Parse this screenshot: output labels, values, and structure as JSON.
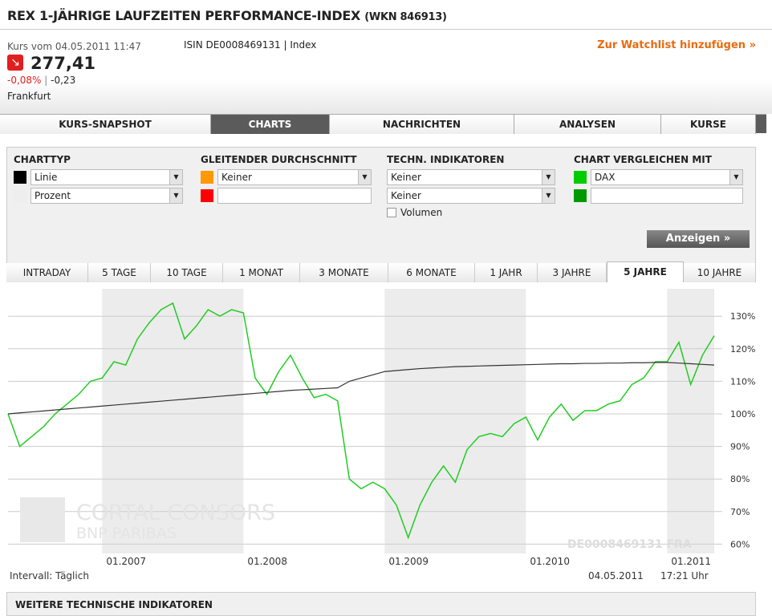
{
  "header": {
    "title": "REX 1-JÄHRIGE LAUFZEITEN PERFORMANCE-INDEX",
    "wkn": "(WKN 846913)",
    "kurs_time": "Kurs vom 04.05.2011 11:47",
    "isin": "ISIN DE0008469131 | Index",
    "price": "277,41",
    "change_pct": "-0,08%",
    "sep": "|",
    "change_abs": "-0,23",
    "exchange": "Frankfurt",
    "watchlist": "Zur Watchlist hinzufügen »",
    "trend_icon": "arrow-down-right-icon",
    "down_color": "#e02020"
  },
  "tabs": [
    {
      "label": "KURS-SNAPSHOT"
    },
    {
      "label": "CHARTS",
      "active": true
    },
    {
      "label": "NACHRICHTEN"
    },
    {
      "label": "ANALYSEN"
    },
    {
      "label": "KURSE"
    }
  ],
  "form": {
    "charttyp": {
      "label": "CHARTTYP",
      "sel1": "Linie",
      "sel2": "Prozent",
      "color1": "#000000",
      "color2": "#eeeeee"
    },
    "gd": {
      "label": "GLEITENDER DURCHSCHNITT",
      "sel1": "Keiner",
      "input2": "",
      "color1": "#ff9900",
      "color2": "#ff0000"
    },
    "ti": {
      "label": "TECHN. INDIKATOREN",
      "sel1": "Keiner",
      "sel2": "Keiner",
      "volumen": "Volumen",
      "volumen_checked": false
    },
    "cmp": {
      "label": "CHART VERGLEICHEN MIT",
      "sel1": "DAX",
      "input2": "",
      "color1": "#00cc00",
      "color2": "#009900"
    },
    "button": "Anzeigen »"
  },
  "periods": [
    {
      "label": "INTRADAY"
    },
    {
      "label": "5 TAGE"
    },
    {
      "label": "10 TAGE"
    },
    {
      "label": "1 MONAT"
    },
    {
      "label": "3 MONATE"
    },
    {
      "label": "6 MONATE"
    },
    {
      "label": "1 JAHR"
    },
    {
      "label": "3 JAHRE"
    },
    {
      "label": "5 JAHRE",
      "active": true
    },
    {
      "label": "10 JAHRE"
    }
  ],
  "chart_data": {
    "type": "line",
    "x": [
      "2006-05",
      "2006-06",
      "2006-07",
      "2006-08",
      "2006-09",
      "2006-10",
      "2006-11",
      "2006-12",
      "2007-01",
      "2007-02",
      "2007-03",
      "2007-04",
      "2007-05",
      "2007-06",
      "2007-07",
      "2007-08",
      "2007-09",
      "2007-10",
      "2007-11",
      "2007-12",
      "2008-01",
      "2008-02",
      "2008-03",
      "2008-04",
      "2008-05",
      "2008-06",
      "2008-07",
      "2008-08",
      "2008-09",
      "2008-10",
      "2008-11",
      "2008-12",
      "2009-01",
      "2009-02",
      "2009-03",
      "2009-04",
      "2009-05",
      "2009-06",
      "2009-07",
      "2009-08",
      "2009-09",
      "2009-10",
      "2009-11",
      "2009-12",
      "2010-01",
      "2010-02",
      "2010-03",
      "2010-04",
      "2010-05",
      "2010-06",
      "2010-07",
      "2010-08",
      "2010-09",
      "2010-10",
      "2010-11",
      "2010-12",
      "2011-01",
      "2011-02",
      "2011-03",
      "2011-04",
      "2011-05"
    ],
    "series": [
      {
        "name": "DAX",
        "color": "#22cc22",
        "values": [
          100,
          90,
          93,
          96,
          100,
          103,
          106,
          110,
          111,
          116,
          115,
          123,
          128,
          132,
          134,
          123,
          127,
          132,
          130,
          132,
          131,
          111,
          106,
          113,
          118,
          111,
          105,
          106,
          104,
          80,
          77,
          79,
          77,
          72,
          62,
          72,
          79,
          84,
          79,
          89,
          93,
          94,
          93,
          97,
          99,
          92,
          99,
          103,
          98,
          101,
          101,
          103,
          104,
          109,
          111,
          116,
          116,
          122,
          109,
          118,
          124
        ]
      },
      {
        "color": "#333333",
        "values": [
          100,
          100.3,
          100.6,
          100.9,
          101.2,
          101.5,
          101.8,
          102.1,
          102.4,
          102.7,
          103,
          103.3,
          103.6,
          103.9,
          104.2,
          104.5,
          104.8,
          105.1,
          105.4,
          105.7,
          106,
          106.3,
          106.6,
          106.9,
          107.2,
          107.4,
          107.6,
          107.8,
          108,
          110,
          111,
          112,
          113,
          113.3,
          113.6,
          113.9,
          114.1,
          114.3,
          114.5,
          114.6,
          114.7,
          114.8,
          114.9,
          115,
          115.1,
          115.2,
          115.3,
          115.4,
          115.4,
          115.5,
          115.5,
          115.6,
          115.6,
          115.7,
          115.7,
          115.8,
          115.8,
          115.6,
          115.4,
          115.2,
          115
        ]
      }
    ],
    "yticks": [
      130,
      120,
      110,
      100,
      90,
      80,
      70,
      60
    ],
    "ytick_suffix": "%",
    "ylim": [
      58,
      137
    ],
    "xticks": [
      "01.2007",
      "01.2008",
      "01.2009",
      "01.2010",
      "01.2011"
    ],
    "shaded_years": [
      "2007",
      "2009",
      "2011"
    ],
    "grid": true
  },
  "chart_footer": {
    "interval": "Intervall: Täglich",
    "date": "04.05.2011",
    "time": "17:21 Uhr",
    "watermark": "CORTAL CONSORS",
    "watermark2": "BNP PARIBAS",
    "isin_mark": "DE0008469131 FRA"
  },
  "bottom": {
    "title": "WEITERE TECHNISCHE INDIKATOREN"
  }
}
